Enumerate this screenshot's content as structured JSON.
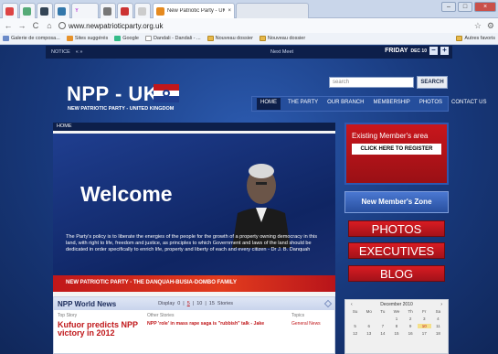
{
  "browser": {
    "tabs": [
      {
        "title": ""
      },
      {
        "title": ""
      },
      {
        "title": "Y"
      },
      {
        "title": ""
      },
      {
        "title": ""
      },
      {
        "title": ""
      },
      {
        "title": "New Patriotic Party - UK"
      },
      {
        "title": ""
      }
    ],
    "url": "www.newpatrioticparty.org.uk",
    "bookmarks": [
      "Galerie de composa...",
      "Sites suggérés",
      "Google",
      "Dandali - Dandali - ...",
      "Nouveau dossier",
      "Nouveau dossier"
    ],
    "bookmarks_right": "Autres favoris"
  },
  "page": {
    "notice_label": "NOTICE",
    "notice_arrows": "« »",
    "next_meet": "Next Meet",
    "day": "FRIDAY",
    "date": "DEC 10",
    "logo": "NPP - UK",
    "logo_sub": "NEW PATRIOTIC PARTY - UNITED KINGDOM",
    "search_placeholder": "search",
    "search_button": "SEARCH",
    "nav": [
      "HOME",
      "THE PARTY",
      "OUR BRANCH",
      "MEMBERSHIP",
      "PHOTOS",
      "CONTACT US"
    ],
    "breadcrumb": "HOME",
    "welcome": "Welcome",
    "hero_text": "The Party's policy is to liberate the energies of the people for the growth of a property owning democracy in this land, with right to life, freedom and justice, as principles to which Government and laws of the land should be dedicated in order specifically to enrich life, property and liberty of each and every citizen - Dr J. B. Danquah",
    "hero_banner": "NEW PATRIOTIC PARTY - THE DANQUAH-BUSIA-DOMBO FAMILY",
    "news": {
      "title": "NPP World News",
      "display_label": "Display",
      "display_options": [
        "0",
        "5",
        "10",
        "15"
      ],
      "display_suffix": "Stories",
      "col_top": "Top Story",
      "col_other": "Other Stories",
      "col_topics": "Topics",
      "top_story": "Kufuor predicts NPP victory in 2012",
      "other_story": "NPP 'role' in mass rape saga is \"rubbish\" talk - Jake",
      "topic": "General News"
    },
    "sidebar": {
      "member_label": "Existing Member's area",
      "register_button": "CLICK HERE TO REGISTER",
      "new_member": "New Member's Zone",
      "photos": "PHOTOS",
      "executives": "EXECUTIVES",
      "blog": "BLOG",
      "calendar_title": "December 2010",
      "calendar_days": [
        "Su",
        "Mo",
        "Tu",
        "We",
        "Th",
        "Fr",
        "Sa"
      ],
      "calendar_dates": [
        "",
        "",
        "",
        "1",
        "2",
        "3",
        "4",
        "5",
        "6",
        "7",
        "8",
        "9",
        "10",
        "11",
        "12",
        "13",
        "14",
        "15",
        "16",
        "17",
        "18"
      ],
      "highlight_date": "10"
    }
  },
  "colors": {
    "accent_red": "#c0171a",
    "navy": "#0d1f4a",
    "blue": "#1f3e8f"
  }
}
